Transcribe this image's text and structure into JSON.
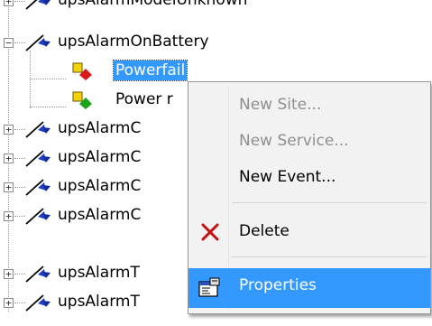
{
  "tree": {
    "rows": [
      {
        "label": "upsAlarmModelUnknown"
      },
      {
        "label": "upsAlarmOnBattery"
      },
      {
        "label": "Powerfail"
      },
      {
        "label": "Power r"
      },
      {
        "label": "upsAlarmC"
      },
      {
        "label": "upsAlarmC"
      },
      {
        "label": "upsAlarmC"
      },
      {
        "label": "upsAlarmC"
      },
      {
        "label": "upsAlarmT"
      },
      {
        "label": "upsAlarmT"
      }
    ]
  },
  "context_menu": {
    "items": [
      {
        "label": "New Site...",
        "enabled": false,
        "icon": ""
      },
      {
        "label": "New Service...",
        "enabled": false,
        "icon": ""
      },
      {
        "label": "New Event...",
        "enabled": true,
        "icon": ""
      },
      {
        "label": "Delete",
        "enabled": true,
        "icon": "delete-x-icon"
      },
      {
        "label": "Properties",
        "enabled": true,
        "icon": "properties-icon",
        "highlighted": true
      }
    ]
  },
  "colors": {
    "selection": "#3399ff",
    "menu_background": "#f2f2f2",
    "disabled_text": "#8f8f8f",
    "delete_icon": "#c41212",
    "node_arrow": "#1f3fbf"
  }
}
